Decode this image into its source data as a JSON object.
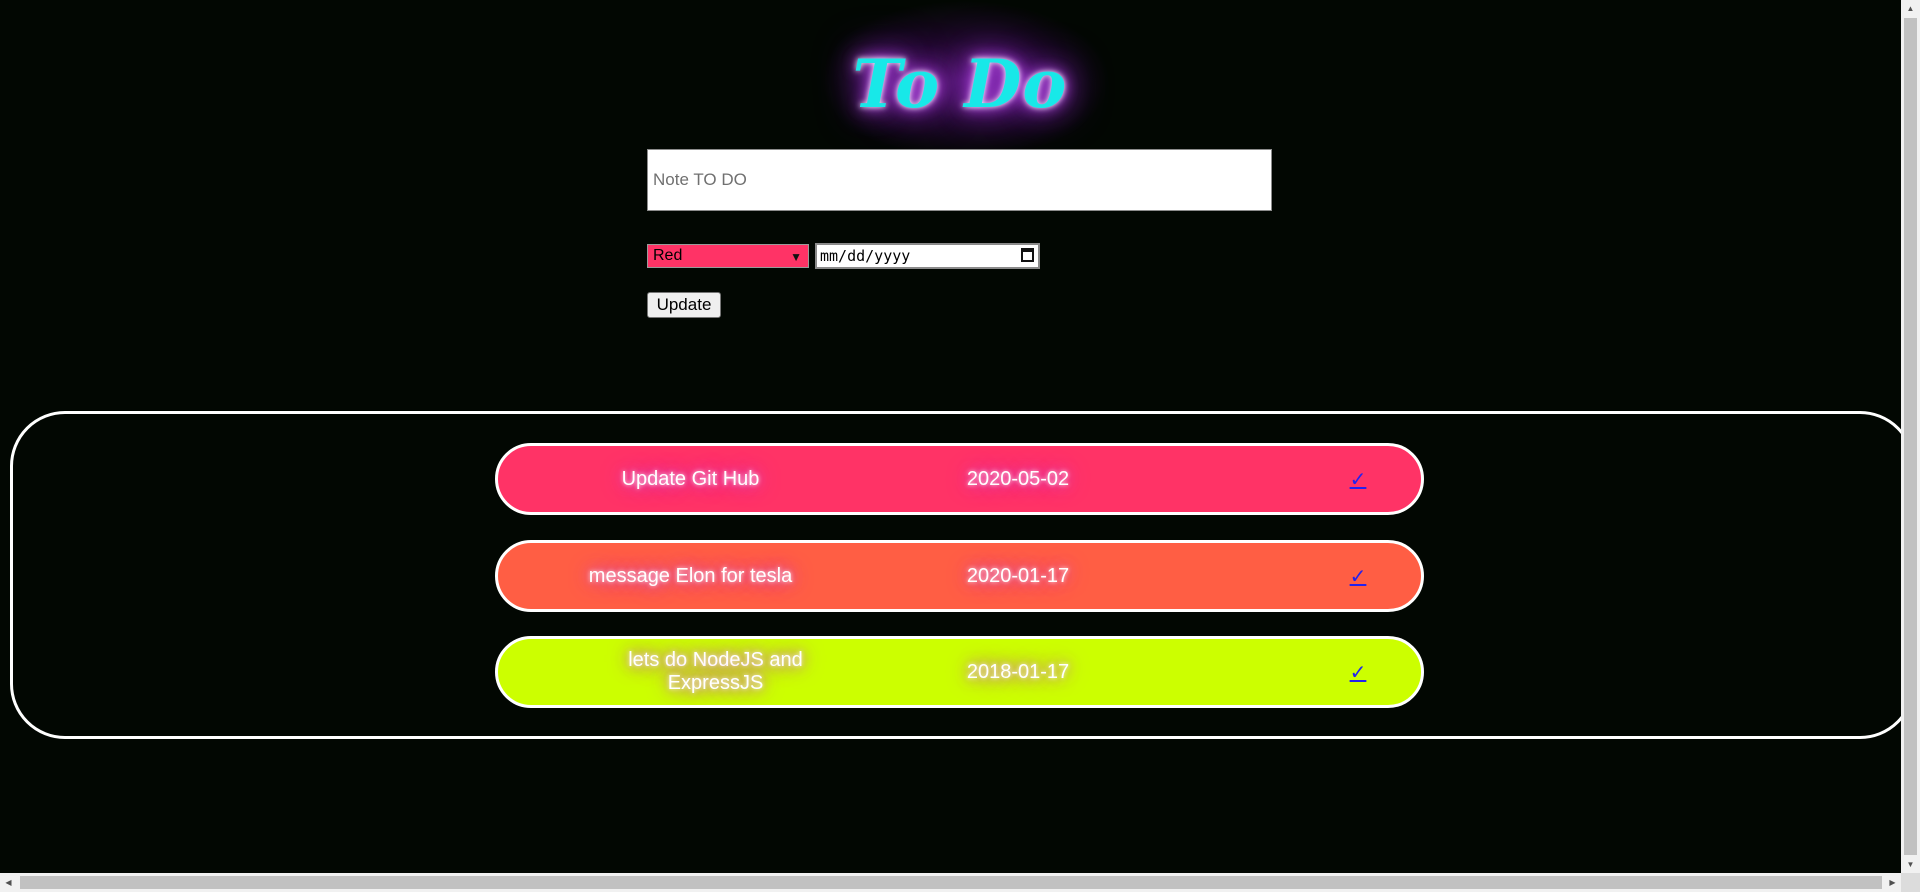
{
  "header": {
    "title": "To Do"
  },
  "form": {
    "note_placeholder": "Note TO DO",
    "note_value": "",
    "color_select": {
      "selected": "Red",
      "color": "#ff3366"
    },
    "date_placeholder": "mm/dd/yyyy",
    "update_label": "Update"
  },
  "todos": [
    {
      "text": "Update Git Hub",
      "date": "2020-05-02",
      "color": "#ff3366",
      "check": "✓"
    },
    {
      "text": "message Elon for tesla",
      "date": "2020-01-17",
      "color": "#ff5e44",
      "check": "✓"
    },
    {
      "text": "lets do NodeJS and ExpressJS",
      "date": "2018-01-17",
      "color": "#ccff00",
      "check": "✓"
    }
  ]
}
